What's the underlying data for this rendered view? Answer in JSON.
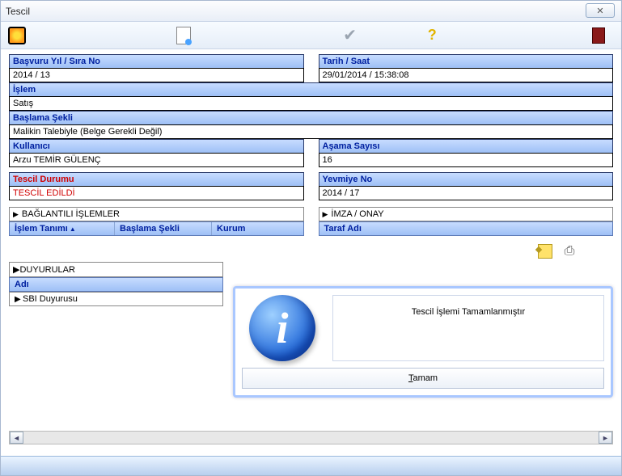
{
  "window": {
    "title": "Tescil"
  },
  "form": {
    "basvuru": {
      "label": "Başvuru Yıl / Sıra No",
      "value": "2014 / 13"
    },
    "tarih": {
      "label": "Tarih / Saat",
      "value": "29/01/2014 / 15:38:08"
    },
    "islem": {
      "label": "İşlem",
      "value": "Satış"
    },
    "baslama": {
      "label": "Başlama Şekli",
      "value": "Malikin Talebiyle (Belge Gerekli Değil)"
    },
    "kullanici": {
      "label": "Kullanıcı",
      "value": "Arzu TEMİR GÜLENÇ"
    },
    "asama": {
      "label": "Aşama Sayısı",
      "value": "16"
    },
    "tescil_durumu": {
      "label": "Tescil Durumu",
      "value": "TESCİL EDİLDİ"
    },
    "yevmiye": {
      "label": "Yevmiye No",
      "value": "2014 / 17"
    }
  },
  "tables": {
    "left": {
      "title": "BAĞLANTILI İŞLEMLER",
      "cols": [
        "İşlem Tanımı",
        "Başlama Şekli",
        "Kurum"
      ]
    },
    "right": {
      "title": "İMZA / ONAY",
      "cols": [
        "Taraf Adı"
      ]
    }
  },
  "duyuru": {
    "title": "DUYURULAR",
    "col": "Adı",
    "rows": [
      "SBI Duyurusu"
    ]
  },
  "dialog": {
    "message": "Tescil İşlemi Tamamlanmıştır",
    "ok_underline": "T",
    "ok_rest": "amam"
  }
}
